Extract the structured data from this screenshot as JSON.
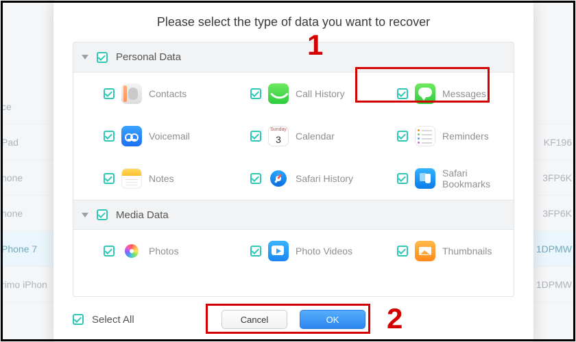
{
  "modal": {
    "title": "Please select the type of data you want to recover",
    "sections": {
      "personal": {
        "header": "Personal Data",
        "items": {
          "contacts": "Contacts",
          "call_history": "Call History",
          "messages": "Messages",
          "voicemail": "Voicemail",
          "calendar": "Calendar",
          "reminders": "Reminders",
          "notes": "Notes",
          "safari_history": "Safari History",
          "safari_bookmarks": "Safari Bookmarks"
        }
      },
      "media": {
        "header": "Media Data",
        "items": {
          "photos": "Photos",
          "photo_videos": "Photo Videos",
          "thumbnails": "Thumbnails"
        }
      }
    },
    "calendar_icon": {
      "weekday": "Sunday",
      "day": "3"
    },
    "select_all": "Select All",
    "buttons": {
      "cancel": "Cancel",
      "ok": "OK"
    }
  },
  "background_list": {
    "row0_left": "ce",
    "row1_left": "Pad",
    "row1_right": "KF196",
    "row2_left": "hone",
    "row2_right": "3FP6K",
    "row3_left": "hone",
    "row3_right": "3FP6K",
    "row4_left": "Phone 7",
    "row4_right": "1DPMW",
    "row5_left": "rimo iPhon",
    "row5_right": "1DPMW"
  },
  "annotations": {
    "one": "1",
    "two": "2"
  }
}
